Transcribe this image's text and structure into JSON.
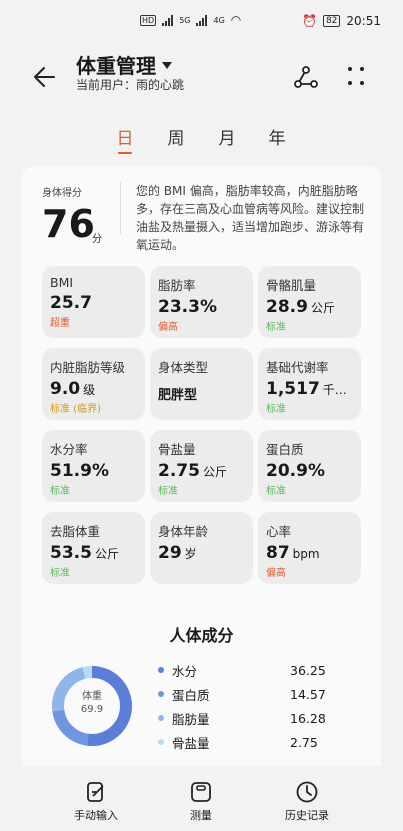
{
  "status_bar": {
    "time": "20:51",
    "battery": "82",
    "signal1": "5G",
    "signal2": "4G",
    "colors": {
      "accent": "#e15c2d"
    }
  },
  "header": {
    "title": "体重管理",
    "current_user": "当前用户：雨的心跳",
    "back_icon": "arrow-left-icon",
    "share_icon": "share-icon",
    "more_icon": "more-icon"
  },
  "tabs": [
    {
      "label": "日",
      "active": true
    },
    {
      "label": "周",
      "active": false
    },
    {
      "label": "月",
      "active": false
    },
    {
      "label": "年",
      "active": false
    }
  ],
  "score": {
    "label": "身体得分",
    "value": "76",
    "unit": "分",
    "advice": "您的 BMI 偏高，脂肪率较高，内脏脂肪略多，存在三高及心血管病等风险。建议控制油盐及热量摄入，适当增加跑步、游泳等有氧运动。"
  },
  "metrics": [
    {
      "label": "BMI",
      "value": "25.7",
      "unit": "",
      "status": "超重",
      "status_color": "#e15c2d"
    },
    {
      "label": "脂肪率",
      "value": "23.3%",
      "unit": "",
      "status": "偏高",
      "status_color": "#e15c2d"
    },
    {
      "label": "骨骼肌量",
      "value": "28.9",
      "unit": "公斤",
      "status": "标准",
      "status_color": "#5cb85c"
    },
    {
      "label": "内脏脂肪等级",
      "value": "9.0",
      "unit": "级",
      "status": "标准 (临界)",
      "status_color": "#d49a1a"
    },
    {
      "label": "身体类型",
      "value": "肥胖型",
      "unit": "",
      "status": "",
      "status_color": "#5cb85c"
    },
    {
      "label": "基础代谢率",
      "value": "1,517",
      "unit": "千…",
      "status": "标准",
      "status_color": "#5cb85c"
    },
    {
      "label": "水分率",
      "value": "51.9%",
      "unit": "",
      "status": "标准",
      "status_color": "#5cb85c"
    },
    {
      "label": "骨盐量",
      "value": "2.75",
      "unit": "公斤",
      "status": "标准",
      "status_color": "#5cb85c"
    },
    {
      "label": "蛋白质",
      "value": "20.9%",
      "unit": "",
      "status": "标准",
      "status_color": "#5cb85c"
    },
    {
      "label": "去脂体重",
      "value": "53.5",
      "unit": "公斤",
      "status": "标准",
      "status_color": "#5cb85c"
    },
    {
      "label": "身体年龄",
      "value": "29",
      "unit": "岁",
      "status": "",
      "status_color": "#5cb85c"
    },
    {
      "label": "心率",
      "value": "87",
      "unit": "bpm",
      "status": "偏高",
      "status_color": "#e15c2d"
    }
  ],
  "composition": {
    "title": "人体成分",
    "center_label": "体重",
    "center_value": "69.9",
    "items": [
      {
        "name": "水分",
        "value": "36.25",
        "color": "#5b7fd9"
      },
      {
        "name": "蛋白质",
        "value": "14.57",
        "color": "#6f96e0"
      },
      {
        "name": "脂肪量",
        "value": "16.28",
        "color": "#8fb6ea"
      },
      {
        "name": "骨盐量",
        "value": "2.75",
        "color": "#b9dbf2"
      }
    ]
  },
  "bottom_nav": [
    {
      "label": "手动输入",
      "icon": "edit-icon"
    },
    {
      "label": "测量",
      "icon": "scale-icon"
    },
    {
      "label": "历史记录",
      "icon": "clock-icon"
    }
  ]
}
